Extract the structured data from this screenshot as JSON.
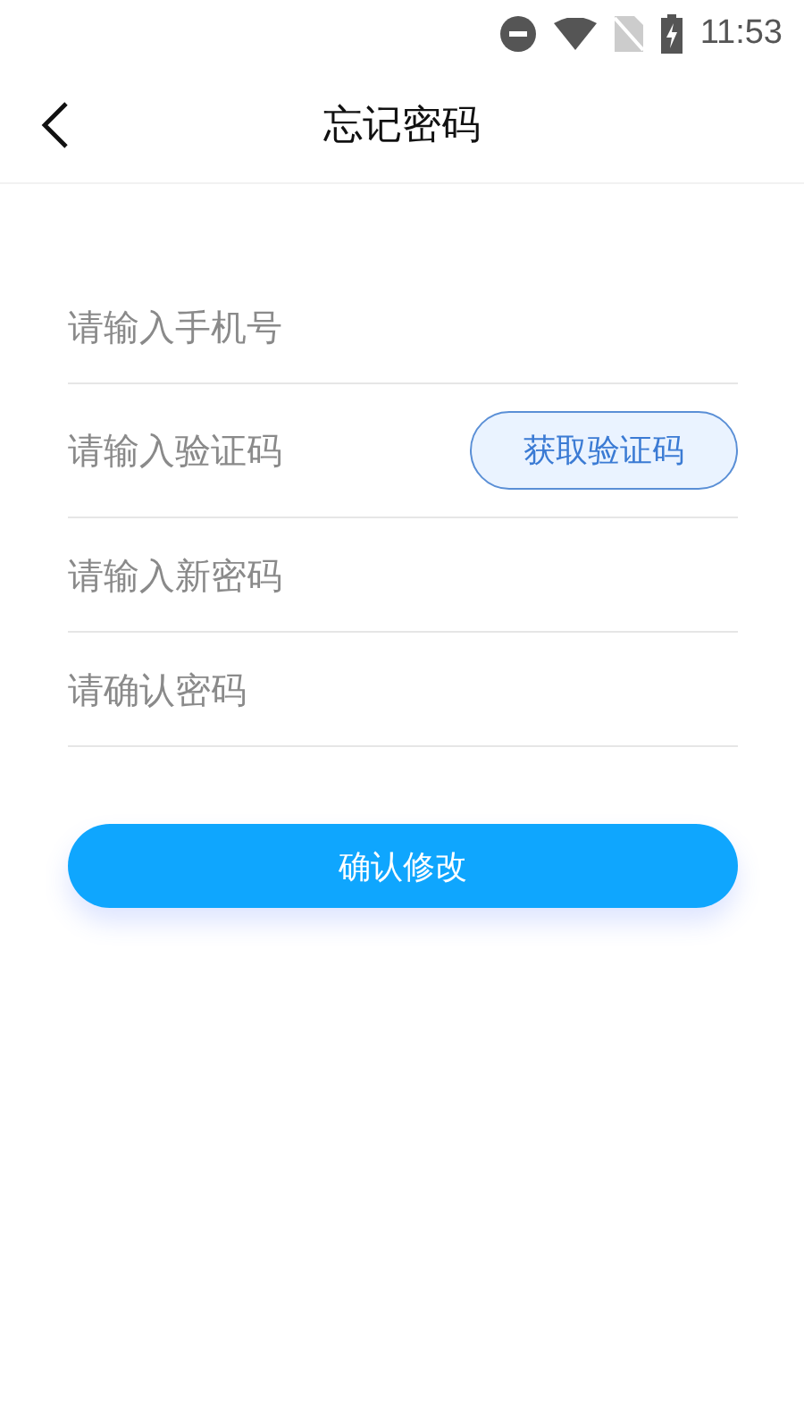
{
  "status_bar": {
    "time": "11:53"
  },
  "header": {
    "title": "忘记密码"
  },
  "fields": [
    {
      "kind": "plain",
      "placeholder": "请输入手机号"
    },
    {
      "kind": "code",
      "placeholder": "请输入验证码",
      "button": "获取验证码"
    },
    {
      "kind": "plain",
      "placeholder": "请输入新密码"
    },
    {
      "kind": "plain",
      "placeholder": "请确认密码"
    }
  ],
  "submit_button": "确认修改"
}
